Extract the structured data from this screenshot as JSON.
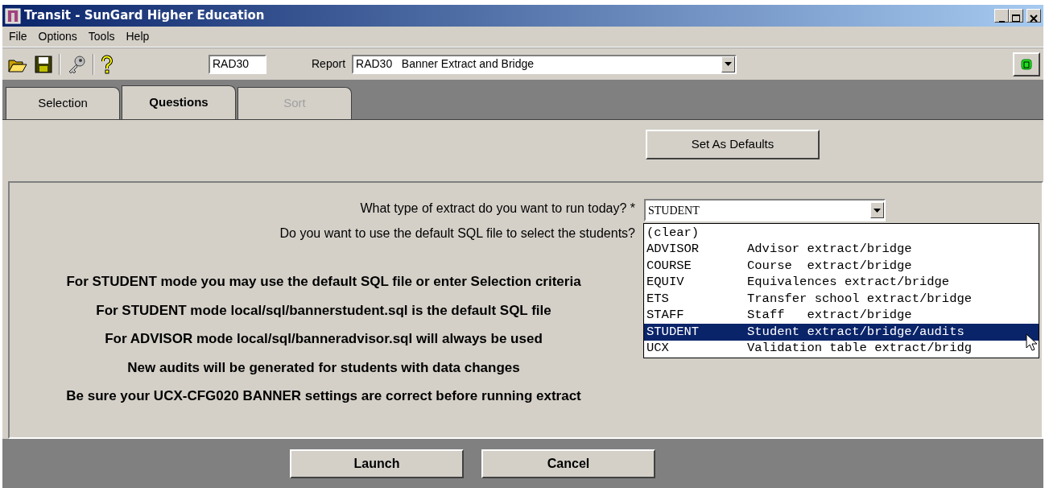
{
  "window": {
    "title": "Transit - SunGard Higher Education"
  },
  "menu": [
    "File",
    "Options",
    "Tools",
    "Help"
  ],
  "toolbar": {
    "report_code": "RAD30",
    "report_label": "Report",
    "report_value": "RAD30   Banner Extract and Bridge"
  },
  "tabs": [
    {
      "label": "Selection",
      "selected": false,
      "disabled": false
    },
    {
      "label": "Questions",
      "selected": true,
      "disabled": false
    },
    {
      "label": "Sort",
      "selected": false,
      "disabled": true
    }
  ],
  "set_defaults_button": "Set As Defaults",
  "questions": [
    {
      "label": "What type of extract do you want to run today? *",
      "value": "STUDENT"
    },
    {
      "label": "Do you want to use the default SQL file to select the students?"
    }
  ],
  "dropdown": {
    "open": true,
    "options": [
      {
        "code": "(clear)",
        "selected": false
      },
      {
        "code": "ADVISOR",
        "description": "Advisor extract/bridge",
        "selected": false
      },
      {
        "code": "COURSE",
        "description": "Course  extract/bridge",
        "selected": false
      },
      {
        "code": "EQUIV",
        "description": "Equivalences extract/bridge",
        "selected": false
      },
      {
        "code": "ETS",
        "description": "Transfer school extract/bridge",
        "selected": false
      },
      {
        "code": "STAFF",
        "description": "Staff   extract/bridge",
        "selected": false
      },
      {
        "code": "STUDENT",
        "description": "Student extract/bridge/audits",
        "selected": true
      },
      {
        "code": "UCX",
        "description": "Validation table extract/bridg",
        "selected": false
      }
    ]
  },
  "notes": [
    "For STUDENT mode you may use the default SQL file or enter Selection criteria",
    "For STUDENT mode local/sql/bannerstudent.sql is the default SQL file",
    "For ADVISOR mode local/sql/banneradvisor.sql will always be used",
    "New audits will be generated for students with data changes",
    "Be sure your UCX-CFG020 BANNER settings are correct before running extract"
  ],
  "buttons": [
    "Launch",
    "Cancel"
  ]
}
